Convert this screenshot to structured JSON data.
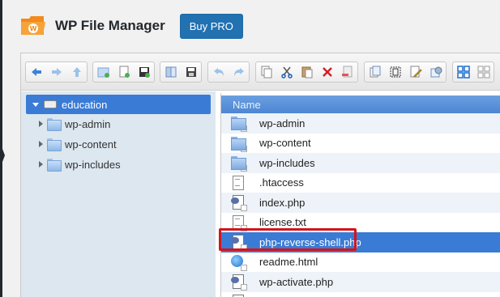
{
  "header": {
    "title": "WP File Manager",
    "buy_pro_label": "Buy PRO",
    "logo_icon": "wp-file-manager-logo"
  },
  "toolbar": {
    "groups": [
      [
        "back-icon",
        "forward-icon",
        "up-icon"
      ],
      [
        "mkdir-icon",
        "mkfile-icon",
        "upload-icon"
      ],
      [
        "open-icon",
        "save-icon"
      ],
      [
        "undo-icon",
        "redo-icon"
      ],
      [
        "copy-icon",
        "cut-icon",
        "paste-icon",
        "delete-icon",
        "empty-icon"
      ],
      [
        "duplicate-icon",
        "select-icon",
        "edit-icon",
        "resize-icon"
      ],
      [
        "view-icons-icon",
        "view-list-icon"
      ]
    ]
  },
  "tree": {
    "root": "education",
    "items": [
      "wp-admin",
      "wp-content",
      "wp-includes"
    ]
  },
  "list": {
    "column_name": "Name",
    "rows": [
      {
        "name": "wp-admin",
        "type": "folder"
      },
      {
        "name": "wp-content",
        "type": "folder"
      },
      {
        "name": "wp-includes",
        "type": "folder"
      },
      {
        "name": ".htaccess",
        "type": "doc"
      },
      {
        "name": "index.php",
        "type": "php"
      },
      {
        "name": "license.txt",
        "type": "doc"
      },
      {
        "name": "php-reverse-shell.php",
        "type": "php",
        "selected": true
      },
      {
        "name": "readme.html",
        "type": "html"
      },
      {
        "name": "wp-activate.php",
        "type": "php"
      }
    ]
  },
  "colors": {
    "accent": "#2271b1",
    "selection": "#3a7bd5",
    "highlight_border": "#d4141b"
  }
}
